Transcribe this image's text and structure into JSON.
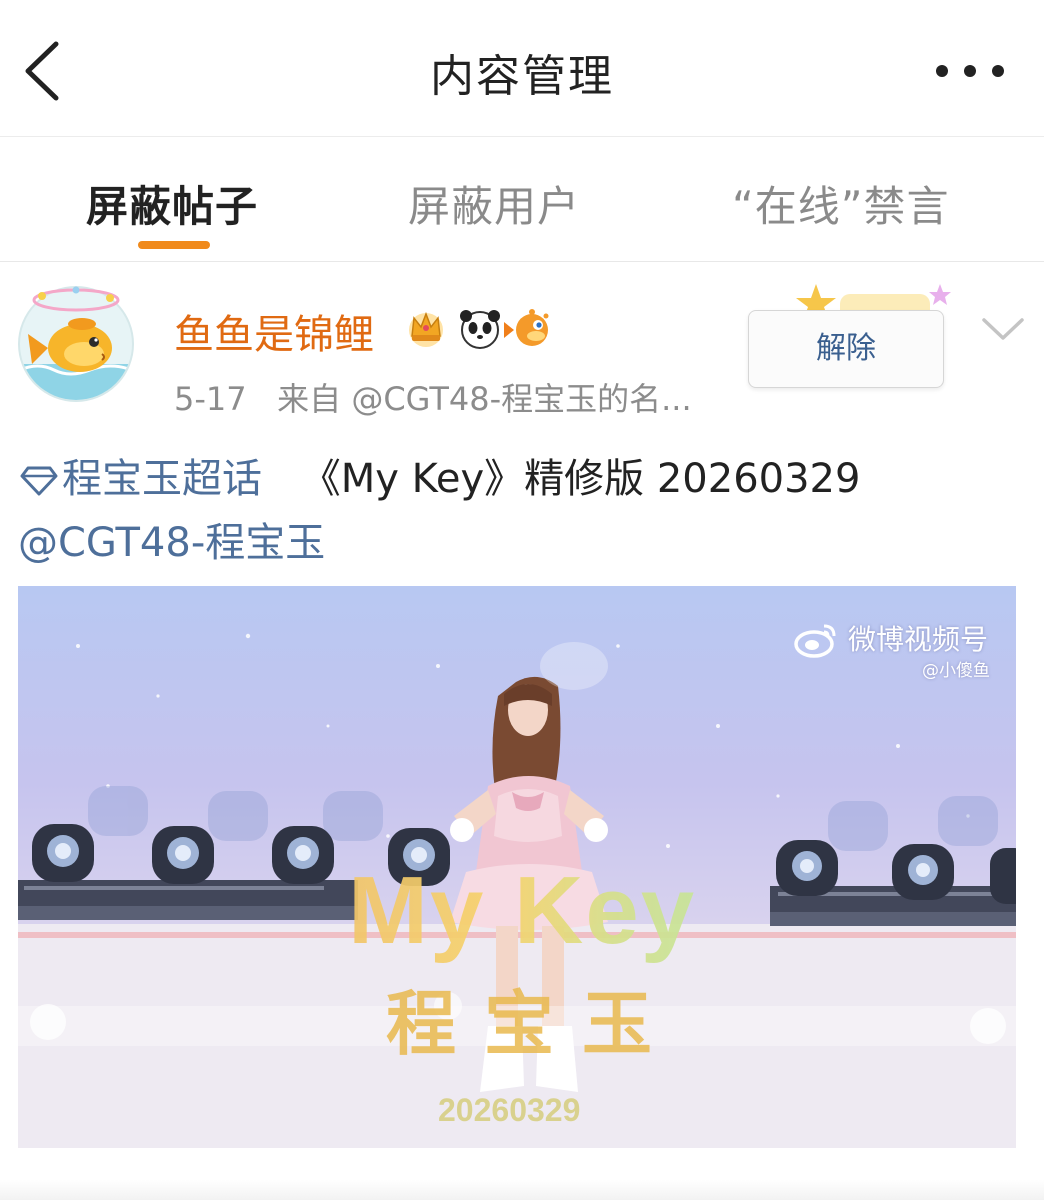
{
  "header": {
    "title": "内容管理",
    "back_icon": "chevron-left-icon",
    "more_icon": "more-horizontal-icon"
  },
  "tabs": [
    {
      "label": "屏蔽帖子",
      "active": true
    },
    {
      "label": "屏蔽用户",
      "active": false
    },
    {
      "label": "“在线”禁言",
      "active": false
    }
  ],
  "colors": {
    "accent": "#f08a1c",
    "username": "#e06a12",
    "link": "#4e6f9a"
  },
  "post": {
    "username": "鱼鱼是锦鲤",
    "badges": [
      "crown-badge-icon",
      "panda-badge-icon",
      "pufferfish-badge-icon"
    ],
    "date": "5-17",
    "source": "来自 @CGT48-程宝玉的名...",
    "unblock_label": "解除",
    "topic": "程宝玉超话",
    "text": "《My Key》精修版 20260329",
    "mention": "@CGT48-程宝玉",
    "video": {
      "watermark": "微博视频号",
      "watermark_sub": "@小傻鱼",
      "overlay_title": "My Key",
      "overlay_name": "程宝玉",
      "overlay_date": "20260329"
    }
  }
}
